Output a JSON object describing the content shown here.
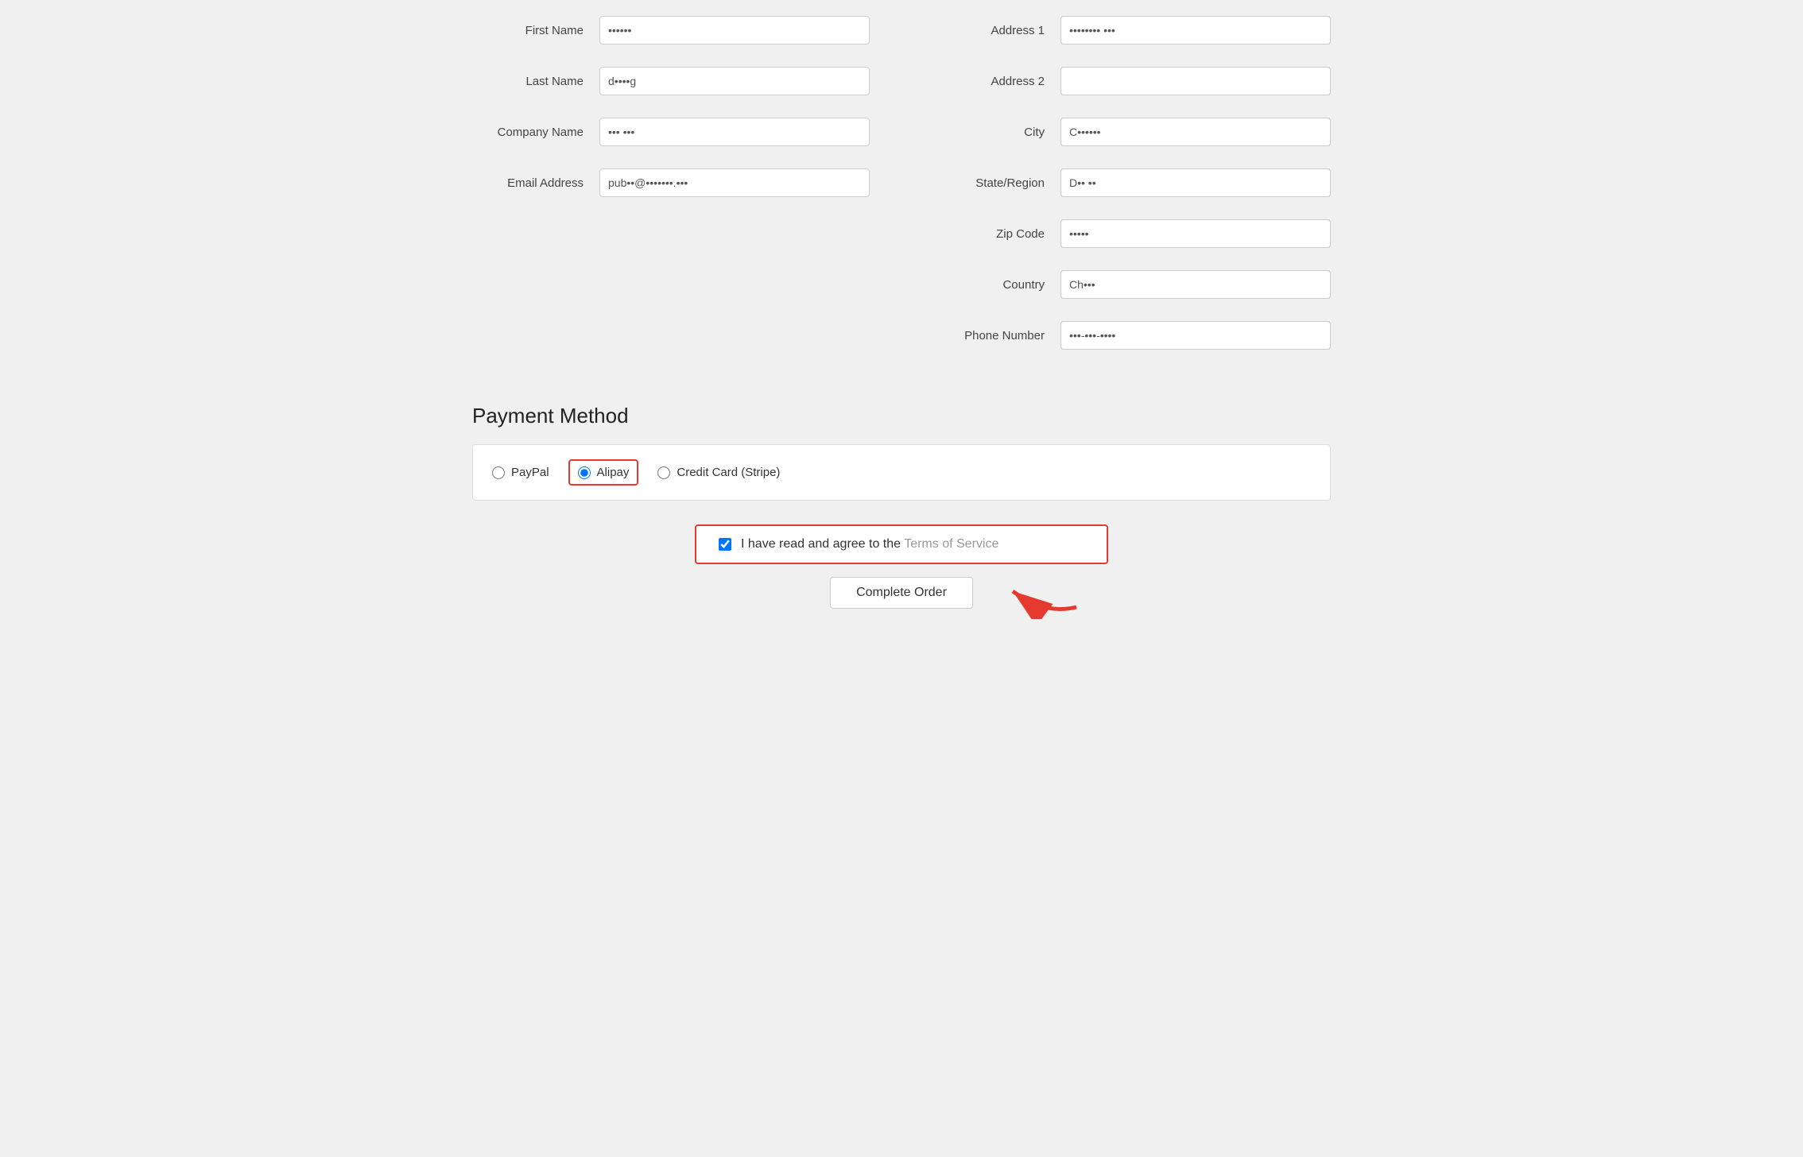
{
  "form": {
    "left_column": {
      "fields": [
        {
          "label": "First Name",
          "value": "••••••",
          "id": "first-name"
        },
        {
          "label": "Last Name",
          "value": "d••••g",
          "id": "last-name"
        },
        {
          "label": "Company Name",
          "value": "••• •••",
          "id": "company-name"
        },
        {
          "label": "Email Address",
          "value": "pub••@•••••••.•••",
          "id": "email-address"
        }
      ]
    },
    "right_column": {
      "fields": [
        {
          "label": "Address 1",
          "value": "•••••••• •••",
          "id": "address1"
        },
        {
          "label": "Address 2",
          "value": "",
          "id": "address2"
        },
        {
          "label": "City",
          "value": "C••••••",
          "id": "city"
        },
        {
          "label": "State/Region",
          "value": "D•• ••",
          "id": "state"
        },
        {
          "label": "Zip Code",
          "value": "•••••",
          "id": "zip"
        },
        {
          "label": "Country",
          "value": "Ch•••",
          "id": "country"
        },
        {
          "label": "Phone Number",
          "value": "•••-•••-••••",
          "id": "phone"
        }
      ]
    }
  },
  "payment": {
    "section_title": "Payment Method",
    "options": [
      {
        "id": "paypal",
        "label": "PayPal",
        "checked": false
      },
      {
        "id": "alipay",
        "label": "Alipay",
        "checked": true
      },
      {
        "id": "credit-card",
        "label": "Credit Card (Stripe)",
        "checked": false
      }
    ]
  },
  "tos": {
    "checkbox_checked": true,
    "text_prefix": "I have read and agree to the ",
    "link_text": "Terms of Service"
  },
  "buttons": {
    "complete_order": "Complete Order"
  }
}
